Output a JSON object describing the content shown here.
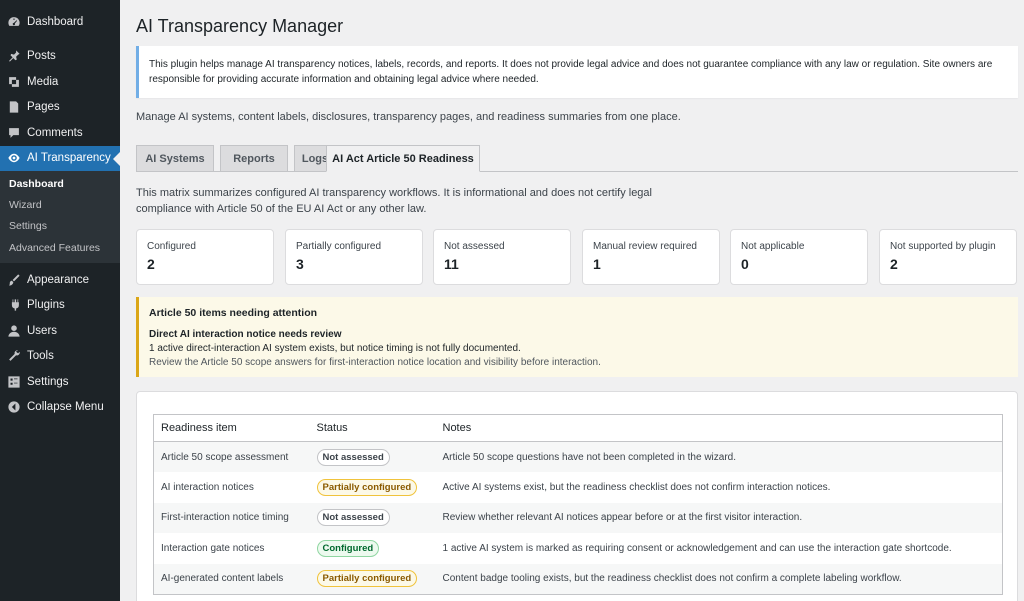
{
  "sidebar": {
    "items": [
      {
        "label": "Dashboard",
        "icon": "dashboard-icon"
      },
      {
        "label": "Posts",
        "icon": "pin-icon"
      },
      {
        "label": "Media",
        "icon": "media-icon"
      },
      {
        "label": "Pages",
        "icon": "pages-icon"
      },
      {
        "label": "Comments",
        "icon": "comments-icon"
      },
      {
        "label": "AI Transparency",
        "icon": "eye-icon"
      }
    ],
    "submenu": [
      "Dashboard",
      "Wizard",
      "Settings",
      "Advanced Features"
    ],
    "items2": [
      {
        "label": "Appearance",
        "icon": "brush-icon"
      },
      {
        "label": "Plugins",
        "icon": "plug-icon"
      },
      {
        "label": "Users",
        "icon": "user-icon"
      },
      {
        "label": "Tools",
        "icon": "wrench-icon"
      },
      {
        "label": "Settings",
        "icon": "settings-icon"
      },
      {
        "label": "Collapse Menu",
        "icon": "collapse-icon"
      }
    ]
  },
  "page": {
    "title": "AI Transparency Manager",
    "notice": "This plugin helps manage AI transparency notices, labels, records, and reports. It does not provide legal advice and does not guarantee compliance with any law or regulation. Site owners are responsible for providing accurate information and obtaining legal advice where needed.",
    "intro": "Manage AI systems, content labels, disclosures, transparency pages, and readiness summaries from one place."
  },
  "tabs": [
    "AI Systems",
    "Reports",
    "Logs",
    "AI Act Article 50 Readiness"
  ],
  "readiness": {
    "description": "This matrix summarizes configured AI transparency workflows. It is informational and does not certify legal compliance with Article 50 of the EU AI Act or any other law.",
    "cards": [
      {
        "label": "Configured",
        "value": "2"
      },
      {
        "label": "Partially configured",
        "value": "3"
      },
      {
        "label": "Not assessed",
        "value": "11"
      },
      {
        "label": "Manual review required",
        "value": "1"
      },
      {
        "label": "Not applicable",
        "value": "0"
      },
      {
        "label": "Not supported by plugin",
        "value": "2"
      }
    ],
    "attention": {
      "heading": "Article 50 items needing attention",
      "item_title": "Direct AI interaction notice needs review",
      "item_text": "1 active direct-interaction AI system exists, but notice timing is not fully documented.",
      "item_hint": "Review the Article 50 scope answers for first-interaction notice location and visibility before interaction."
    },
    "table": {
      "headers": [
        "Readiness item",
        "Status",
        "Notes"
      ],
      "rows": [
        {
          "item": "Article 50 scope assessment",
          "status": "Not assessed",
          "notes": "Article 50 scope questions have not been completed in the wizard."
        },
        {
          "item": "AI interaction notices",
          "status": "Partially configured",
          "notes": "Active AI systems exist, but the readiness checklist does not confirm interaction notices."
        },
        {
          "item": "First-interaction notice timing",
          "status": "Not assessed",
          "notes": "Review whether relevant AI notices appear before or at the first visitor interaction."
        },
        {
          "item": "Interaction gate notices",
          "status": "Configured",
          "notes": "1 active AI system is marked as requiring consent or acknowledgement and can use the interaction gate shortcode."
        },
        {
          "item": "AI-generated content labels",
          "status": "Partially configured",
          "notes": "Content badge tooling exists, but the readiness checklist does not confirm a complete labeling workflow."
        }
      ]
    }
  },
  "colors": {
    "sidebar_bg": "#1d2327",
    "accent": "#2271b1",
    "notice_border": "#72aee6",
    "warning_border": "#dba617"
  }
}
